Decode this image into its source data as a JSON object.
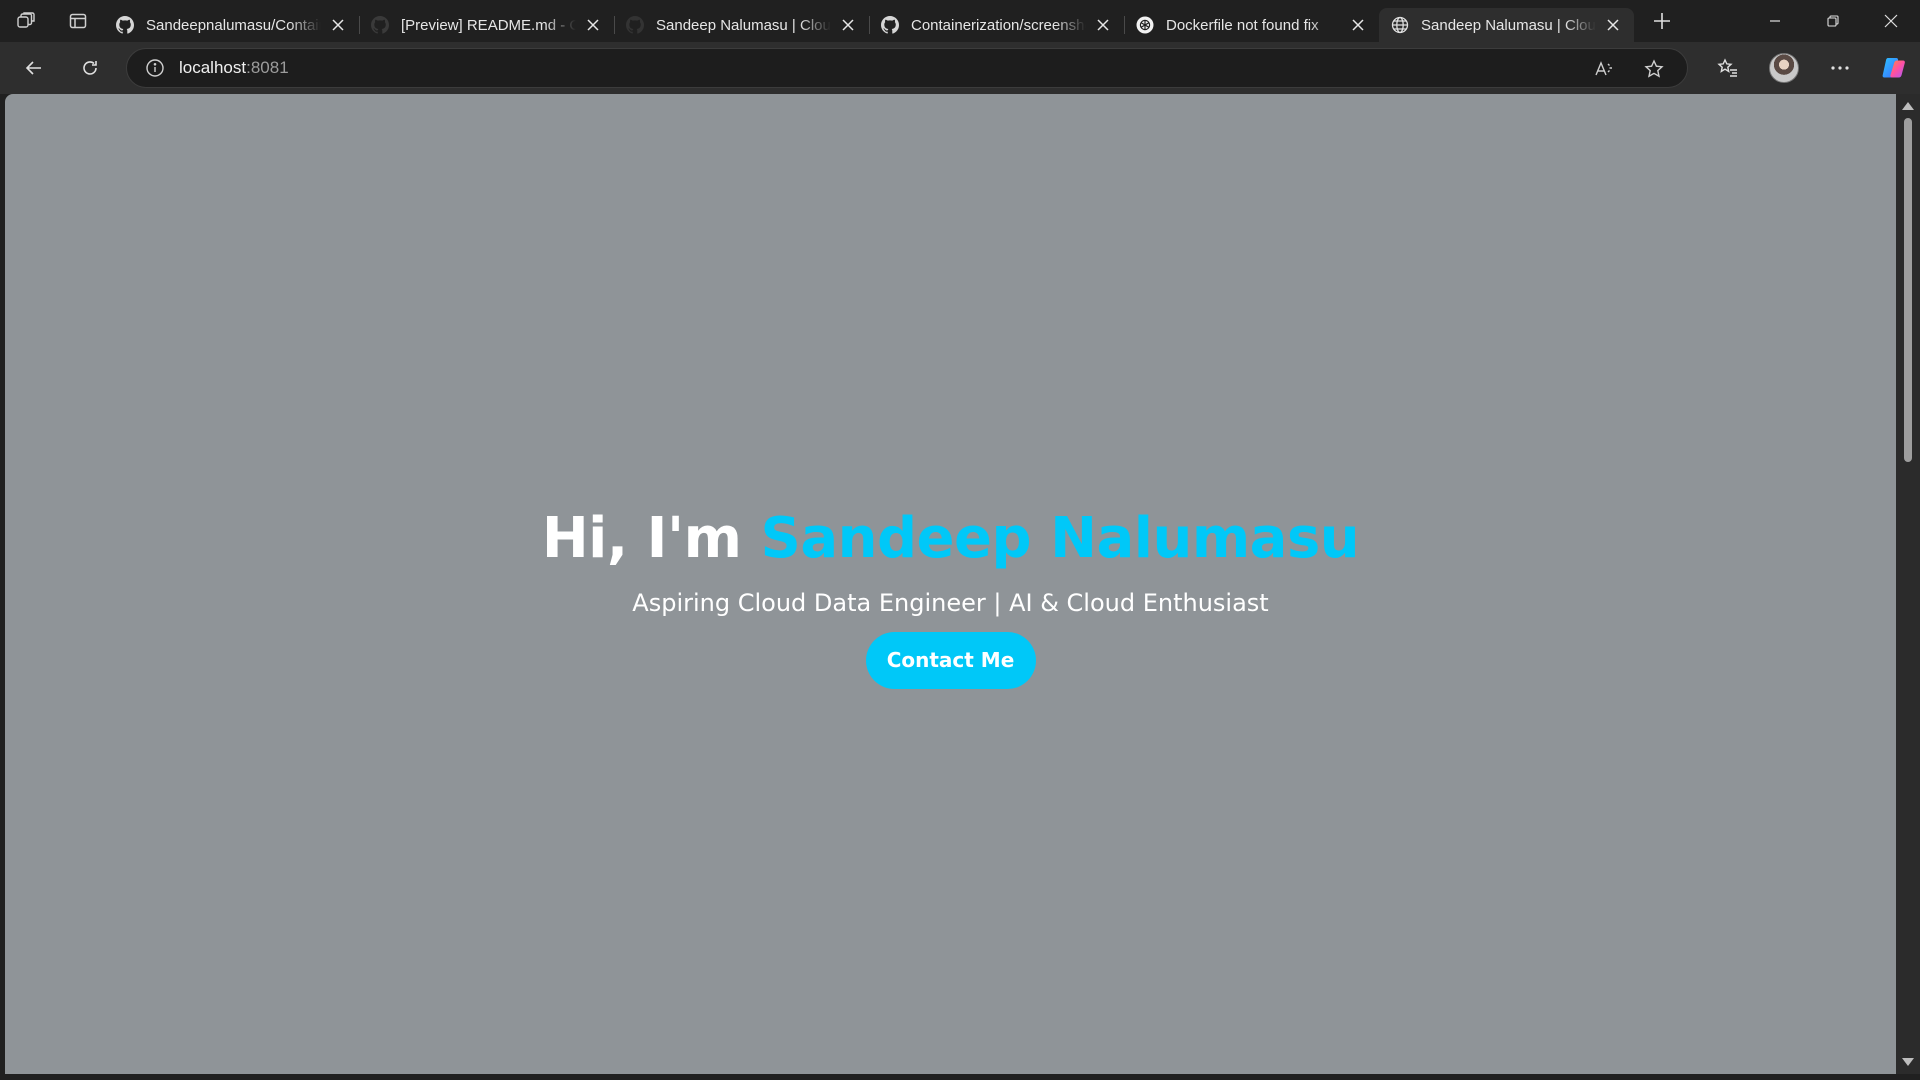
{
  "browser": {
    "tabs": [
      {
        "title": "Sandeepnalumasu/Containerization",
        "icon": "github-icon",
        "active": false
      },
      {
        "title": "[Preview] README.md - Containerization",
        "icon": "github-icon",
        "active": false
      },
      {
        "title": "Sandeep Nalumasu | Cloud Data Engineer",
        "icon": "github-icon",
        "active": false
      },
      {
        "title": "Containerization/screenshots",
        "icon": "github-icon",
        "active": false
      },
      {
        "title": "Dockerfile not found fix",
        "icon": "openai-icon",
        "active": false
      },
      {
        "title": "Sandeep Nalumasu | Cloud Data Engineer",
        "icon": "globe-icon",
        "active": true
      }
    ],
    "address": {
      "host": "localhost",
      "port": ":8081"
    }
  },
  "page": {
    "heading_prefix": "Hi, I'm ",
    "heading_name": "Sandeep Nalumasu",
    "subtitle": "Aspiring Cloud Data Engineer | AI & Cloud Enthusiast",
    "cta_label": "Contact Me"
  },
  "colors": {
    "page_background": "#8f9498",
    "accent": "#00c8f8",
    "browser_chrome": "#202020",
    "toolbar": "#2e2e2e"
  }
}
